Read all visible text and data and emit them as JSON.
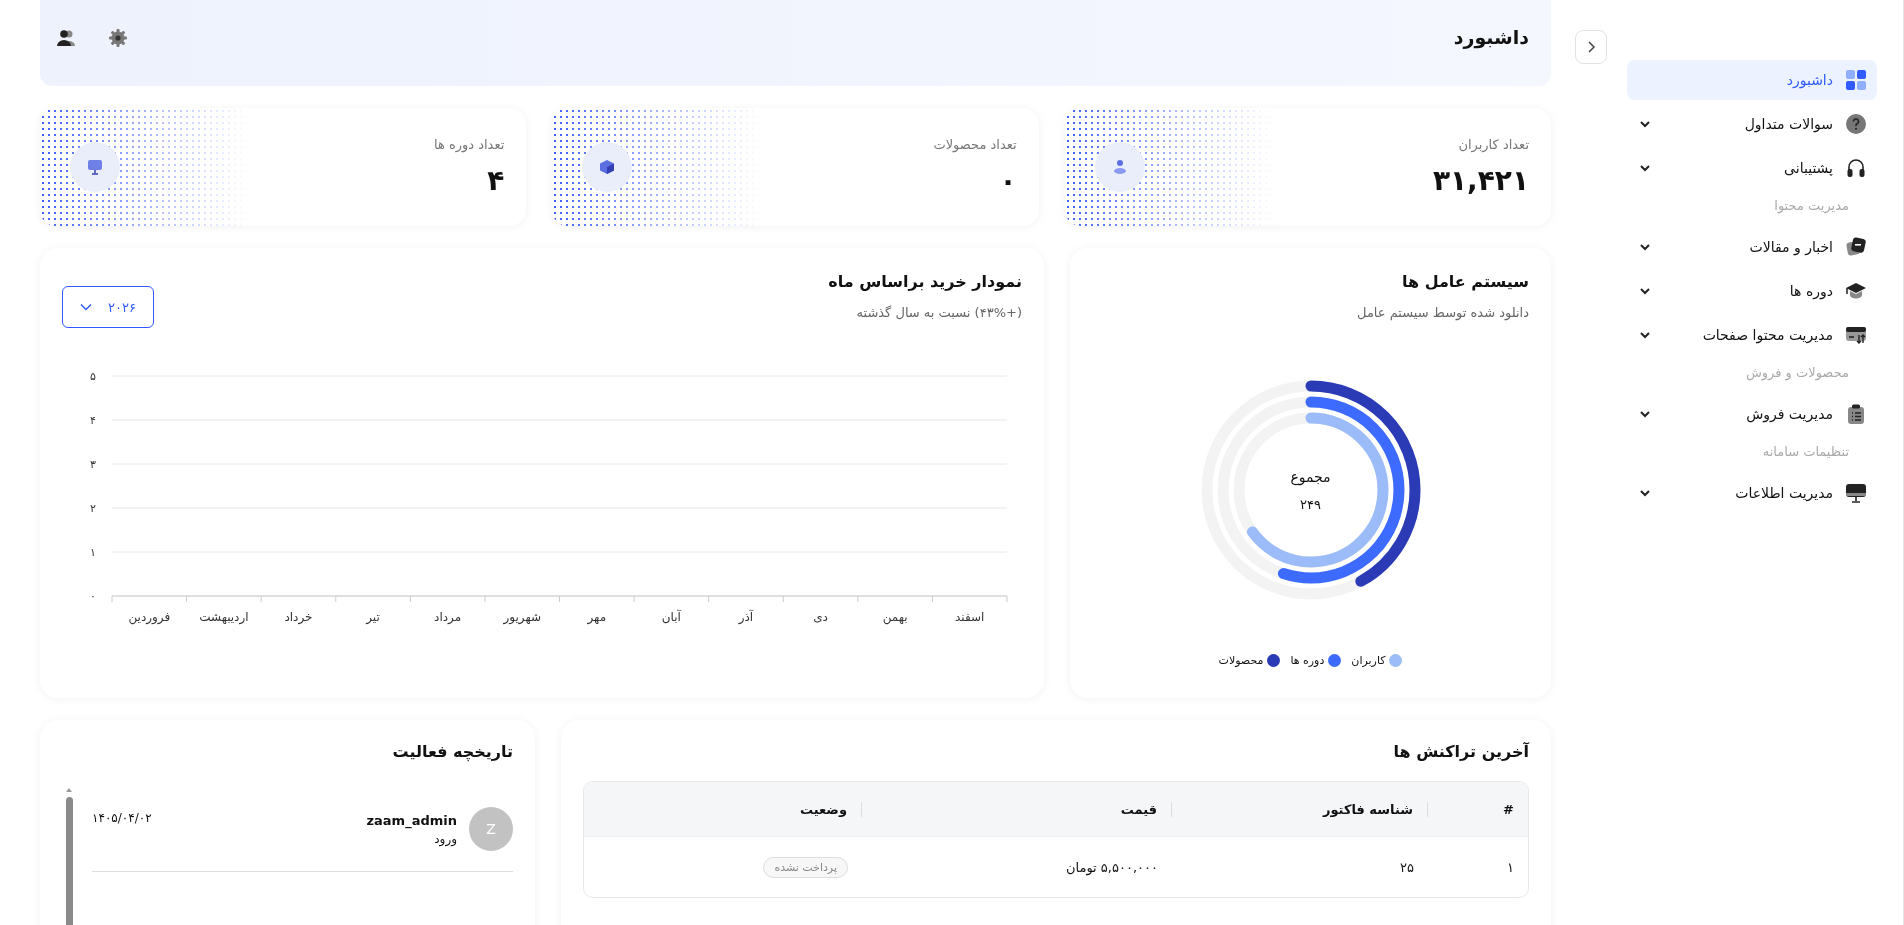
{
  "header": {
    "title": "داشبورد"
  },
  "sidebar": {
    "items": [
      {
        "kind": "item",
        "label": "داشبورد",
        "selected": true,
        "expandable": false
      },
      {
        "kind": "item",
        "label": "سوالات متداول",
        "selected": false,
        "expandable": true
      },
      {
        "kind": "item",
        "label": "پشتیبانی",
        "selected": false,
        "expandable": true
      },
      {
        "kind": "heading",
        "label": "مدیریت محتوا"
      },
      {
        "kind": "item",
        "label": "اخبار و مقالات",
        "selected": false,
        "expandable": true
      },
      {
        "kind": "item",
        "label": "دوره ها",
        "selected": false,
        "expandable": true
      },
      {
        "kind": "item",
        "label": "مدیریت محتوا صفحات",
        "selected": false,
        "expandable": true
      },
      {
        "kind": "heading",
        "label": "محصولات و فروش"
      },
      {
        "kind": "item",
        "label": "مدیریت فروش",
        "selected": false,
        "expandable": true
      },
      {
        "kind": "heading",
        "label": "تنظیمات سامانه"
      },
      {
        "kind": "item",
        "label": "مدیریت اطلاعات",
        "selected": false,
        "expandable": true
      }
    ]
  },
  "stats": [
    {
      "label": "تعداد کاربران",
      "value": "۳۱,۴۲۱"
    },
    {
      "label": "تعداد محصولات",
      "value": "۰"
    },
    {
      "label": "تعداد دوره ها",
      "value": "۴"
    }
  ],
  "os_card": {
    "title": "سیستم عامل ها",
    "subtitle": "دانلود شده توسط سیستم عامل",
    "total_label": "مجموع",
    "total": "۲۴۹",
    "series": [
      {
        "name": "کاربران",
        "color": "#9bbcf8",
        "level": 0.65
      },
      {
        "name": "دوره ها",
        "color": "#3d6bff",
        "level": 0.55
      },
      {
        "name": "محصولات",
        "color": "#2a3bb5",
        "level": 0.42
      }
    ]
  },
  "purchase_chart": {
    "title": "نمودار خرید براساس ماه",
    "subtitle": "(+۴۳%) نسبت به سال گذشته",
    "year": "۲۰۲۶",
    "chart_data": {
      "type": "line",
      "categories": [
        "فروردین",
        "اردیبهشت",
        "خرداد",
        "تیر",
        "مرداد",
        "شهریور",
        "مهر",
        "آبان",
        "آذر",
        "دی",
        "بهمن",
        "اسفند"
      ],
      "values": [
        null,
        null,
        null,
        null,
        null,
        null,
        null,
        null,
        null,
        null,
        null,
        null
      ],
      "ylim": [
        0,
        5
      ],
      "grid": true,
      "yticks": [
        {
          "value": 0,
          "label": "۰"
        },
        {
          "value": 1,
          "label": "۱"
        },
        {
          "value": 2,
          "label": "۲"
        },
        {
          "value": 3,
          "label": "۳"
        },
        {
          "value": 4,
          "label": "۴"
        },
        {
          "value": 5,
          "label": "۵"
        }
      ]
    }
  },
  "transactions": {
    "title": "آخرین تراکنش ها",
    "columns": [
      "#",
      "شناسه فاکتور",
      "قیمت",
      "وضعیت"
    ],
    "rows": [
      {
        "index": "۱",
        "invoice": "۲۵",
        "price": "۵,۵۰۰,۰۰۰ تومان",
        "status": "پرداخت نشده"
      }
    ]
  },
  "activity": {
    "title": "تاریخچه فعالیت",
    "items": [
      {
        "avatar": "Z",
        "user": "zaam_admin",
        "action": "ورود",
        "date": "۱۴۰۵/۰۴/۰۲"
      }
    ]
  }
}
